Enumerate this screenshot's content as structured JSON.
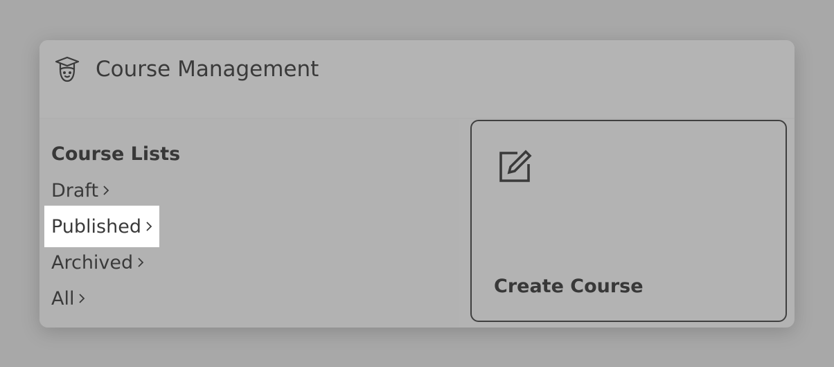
{
  "header": {
    "title": "Course Management",
    "icon": "graduate-icon"
  },
  "course_lists": {
    "heading": "Course Lists",
    "items": [
      {
        "label": "Draft",
        "selected": false
      },
      {
        "label": "Published",
        "selected": true
      },
      {
        "label": "Archived",
        "selected": false
      },
      {
        "label": "All",
        "selected": false
      }
    ]
  },
  "create_course": {
    "label": "Create Course",
    "icon": "edit-icon"
  },
  "colors": {
    "background": "#a8a8a8",
    "card": "#b3b3b3",
    "text": "#3a3a3a",
    "selected_highlight": "#ffffff"
  }
}
